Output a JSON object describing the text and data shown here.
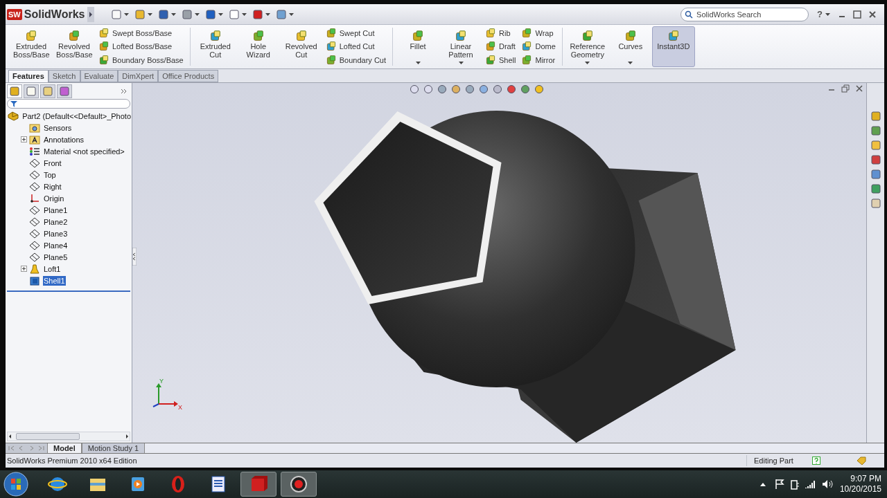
{
  "title_bar": {
    "logo_badge": "SW",
    "app_name": "SolidWorks",
    "search": {
      "placeholder": "SolidWorks Search"
    },
    "help": "?"
  },
  "command_manager": [
    {
      "kind": "large",
      "label": "Extruded Boss/Base",
      "dropdown": false,
      "on": false
    },
    {
      "kind": "large",
      "label": "Revolved Boss/Base",
      "dropdown": false,
      "on": false
    },
    {
      "kind": "stack",
      "items": [
        "Swept Boss/Base",
        "Lofted Boss/Base",
        "Boundary Boss/Base"
      ]
    },
    {
      "kind": "separator"
    },
    {
      "kind": "large",
      "label": "Extruded Cut",
      "dropdown": false,
      "on": false
    },
    {
      "kind": "large",
      "label": "Hole Wizard",
      "dropdown": false,
      "on": false
    },
    {
      "kind": "large",
      "label": "Revolved Cut",
      "dropdown": false,
      "on": false
    },
    {
      "kind": "stack",
      "items": [
        "Swept Cut",
        "Lofted Cut",
        "Boundary Cut"
      ]
    },
    {
      "kind": "separator"
    },
    {
      "kind": "large",
      "label": "Fillet",
      "dropdown": true,
      "on": false
    },
    {
      "kind": "large",
      "label": "Linear Pattern",
      "dropdown": true,
      "on": false
    },
    {
      "kind": "stack",
      "items": [
        "Rib",
        "Draft",
        "Shell"
      ]
    },
    {
      "kind": "stack",
      "items": [
        "Wrap",
        "Dome",
        "Mirror"
      ]
    },
    {
      "kind": "separator"
    },
    {
      "kind": "large",
      "label": "Reference Geometry",
      "dropdown": true,
      "on": false
    },
    {
      "kind": "large",
      "label": "Curves",
      "dropdown": true,
      "on": false
    },
    {
      "kind": "large",
      "label": "Instant3D",
      "dropdown": false,
      "on": true
    }
  ],
  "tabs": [
    {
      "label": "Features",
      "selected": true
    },
    {
      "label": "Sketch",
      "selected": false
    },
    {
      "label": "Evaluate",
      "selected": false
    },
    {
      "label": "DimXpert",
      "selected": false
    },
    {
      "label": "Office Products",
      "selected": false
    }
  ],
  "feature_tree": [
    {
      "label": "Part2  (Default<<Default>_Photo",
      "kind": "part",
      "expander": false,
      "selected": false,
      "children": [
        {
          "label": "Sensors",
          "kind": "sensor",
          "expander": false,
          "selected": false
        },
        {
          "label": "Annotations",
          "kind": "annotation",
          "expander": true,
          "selected": false
        },
        {
          "label": "Material <not specified>",
          "kind": "material",
          "expander": false,
          "selected": false
        },
        {
          "label": "Front",
          "kind": "plane",
          "expander": false,
          "selected": false
        },
        {
          "label": "Top",
          "kind": "plane",
          "expander": false,
          "selected": false
        },
        {
          "label": "Right",
          "kind": "plane",
          "expander": false,
          "selected": false
        },
        {
          "label": "Origin",
          "kind": "origin",
          "expander": false,
          "selected": false
        },
        {
          "label": "Plane1",
          "kind": "plane",
          "expander": false,
          "selected": false
        },
        {
          "label": "Plane2",
          "kind": "plane",
          "expander": false,
          "selected": false
        },
        {
          "label": "Plane3",
          "kind": "plane",
          "expander": false,
          "selected": false
        },
        {
          "label": "Plane4",
          "kind": "plane",
          "expander": false,
          "selected": false
        },
        {
          "label": "Plane5",
          "kind": "plane",
          "expander": false,
          "selected": false
        },
        {
          "label": "Loft1",
          "kind": "loft",
          "expander": true,
          "selected": false
        },
        {
          "label": "Shell1",
          "kind": "shell",
          "expander": false,
          "selected": true
        }
      ]
    }
  ],
  "triad": {
    "x": "X",
    "y": "Y"
  },
  "bottom_tabs": [
    {
      "label": "Model",
      "selected": true
    },
    {
      "label": "Motion Study 1",
      "selected": false
    }
  ],
  "status_bar": {
    "edition": "SolidWorks Premium 2010 x64 Edition",
    "mode": "Editing Part"
  },
  "taskbar": {
    "apps": [
      {
        "active": false
      },
      {
        "active": false
      },
      {
        "active": false
      },
      {
        "active": false
      },
      {
        "active": false
      },
      {
        "active": true
      },
      {
        "active": true
      }
    ],
    "time": "9:07 PM",
    "date": "10/20/2015"
  }
}
